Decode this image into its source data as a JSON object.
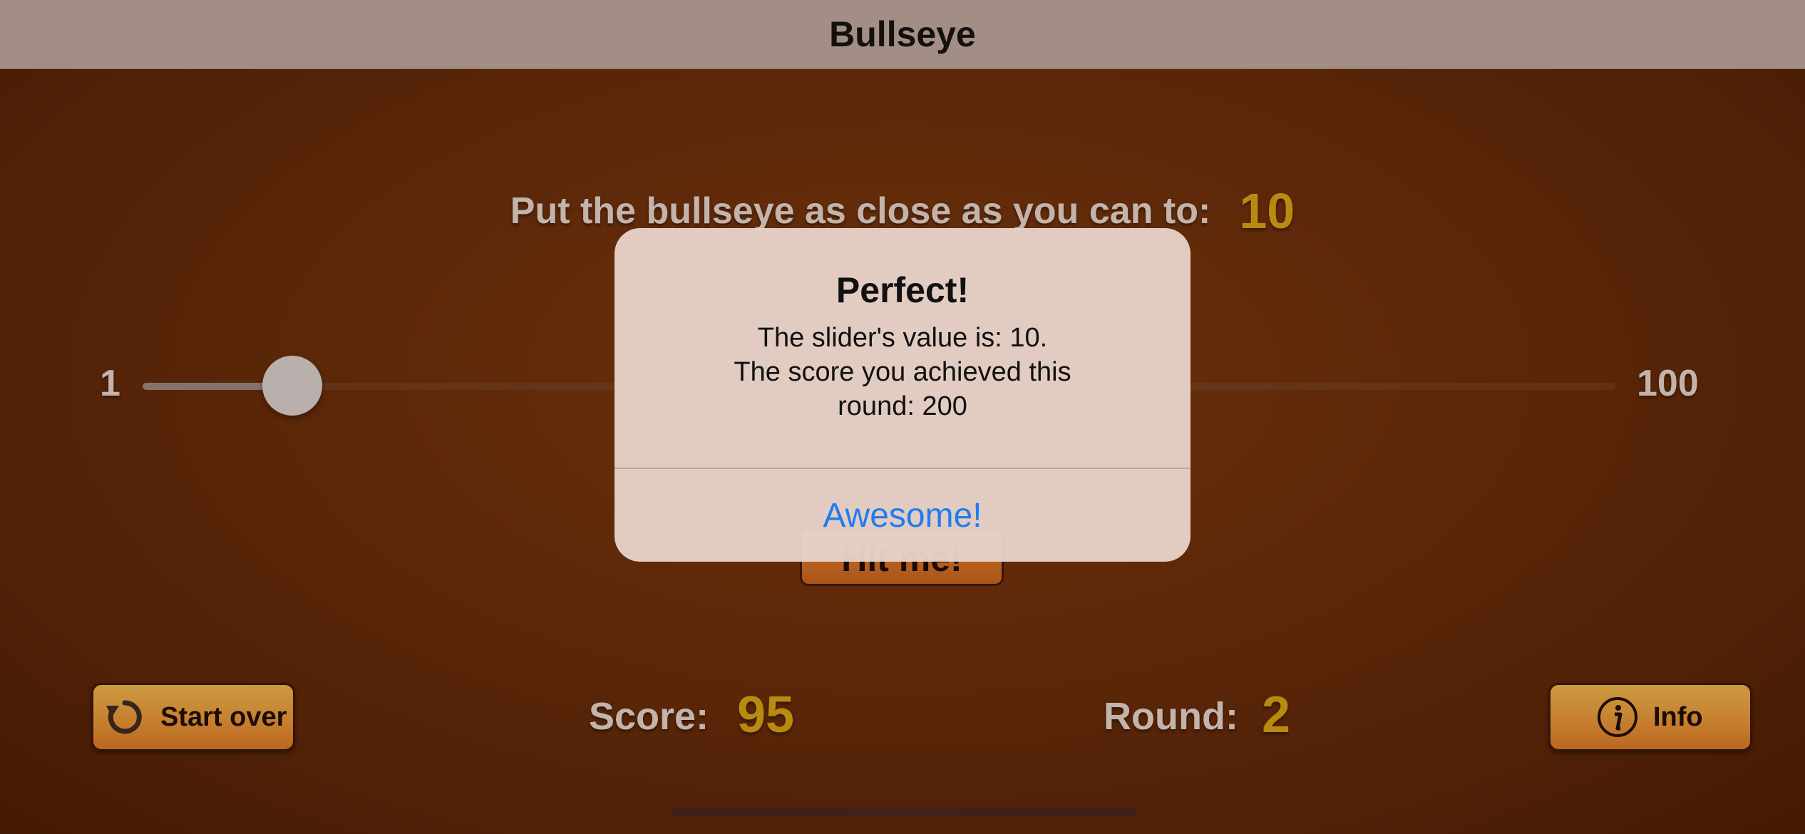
{
  "nav": {
    "title": "Bullseye"
  },
  "game": {
    "target_label": "Put the bullseye as close as you can to:",
    "target_value": "10",
    "slider": {
      "min_label": "1",
      "max_label": "100",
      "value": 10,
      "min": 1,
      "max": 100
    },
    "hit_button_label": "Hit me!",
    "score_label": "Score:",
    "score_value": "95",
    "round_label": "Round:",
    "round_value": "2",
    "start_over_label": "Start over",
    "info_label": "Info"
  },
  "alert": {
    "title": "Perfect!",
    "message_lines": [
      "The slider's value is: 10.",
      "The score you achieved this",
      "round: 200"
    ],
    "action_label": "Awesome!"
  },
  "colors": {
    "accent_gold": "#d9a514",
    "alert_action_blue": "#1f7cf0",
    "button_orange": "#ea9a3a"
  },
  "icons": {
    "start_over": "restart-arrow-icon",
    "info": "info-circle-icon"
  }
}
